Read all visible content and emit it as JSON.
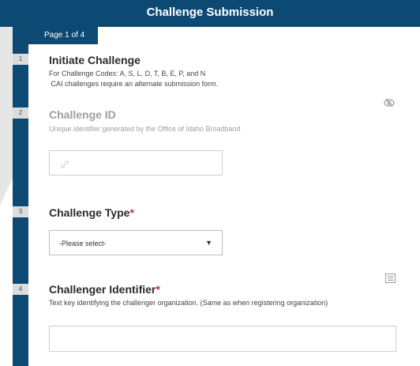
{
  "header": {
    "title": "Challenge Submission"
  },
  "page": {
    "indicator": "Page 1 of 4"
  },
  "sections": [
    {
      "number": "1",
      "title": "Initiate Challenge",
      "line1": "For Challenge Codes: A, S, L, D, T, B, E, P, and N",
      "line2": " CAI challenges require an alternate submission form."
    },
    {
      "number": "2",
      "title": "Challenge ID",
      "help": "Unique identifier generated by the Office of Idaho Broadband",
      "value": ""
    },
    {
      "number": "3",
      "title": "Challenge Type",
      "required_marker": "*",
      "select_value": "-Please select-"
    },
    {
      "number": "4",
      "title": "Challenger Identifier",
      "required_marker": "*",
      "help": "Text key identifying the challenger organization. (Same as when registering organization)",
      "value": ""
    }
  ],
  "icons": {
    "hidden": "eye-slash-icon",
    "id_field": "link-icon",
    "select_caret": "caret-down-icon",
    "field4": "keyboard-icon"
  },
  "colors": {
    "header_bg": "#0d4a73",
    "required": "#d03030"
  }
}
